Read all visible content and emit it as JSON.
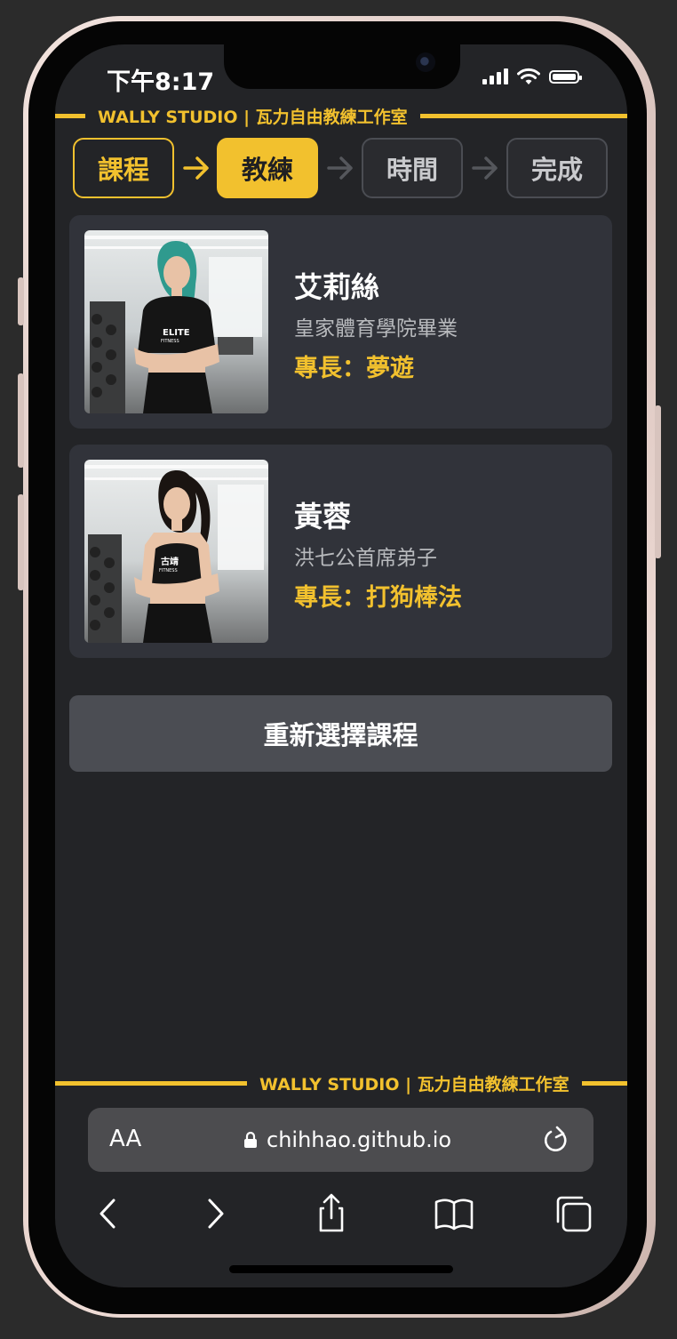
{
  "status": {
    "time": "下午8:17"
  },
  "brand": {
    "text": "WALLY STUDIO | 瓦力自由教練工作室"
  },
  "steps": [
    {
      "label": "課程",
      "state": "done"
    },
    {
      "label": "教練",
      "state": "active"
    },
    {
      "label": "時間",
      "state": "todo"
    },
    {
      "label": "完成",
      "state": "todo"
    }
  ],
  "coaches": [
    {
      "name": "艾莉絲",
      "school": "皇家體育學院畢業",
      "skill": "專長：夢遊",
      "shirt_text": "ELITE",
      "shirt_sub": "FITNESS",
      "hair_color": "#2f9a8e"
    },
    {
      "name": "黃蓉",
      "school": "洪七公首席弟子",
      "skill": "專長：打狗棒法",
      "shirt_text": "古靖",
      "shirt_sub": "FITNESS",
      "hair_color": "#1a1411"
    }
  ],
  "actions": {
    "reselect_label": "重新選擇課程"
  },
  "browser": {
    "aa_label": "AA",
    "url": "chihhao.github.io"
  },
  "colors": {
    "accent": "#f2c12e",
    "card": "#31333a",
    "screen": "#232427",
    "button": "#4b4d53"
  },
  "icons": [
    "signal-icon",
    "wifi-icon",
    "battery-icon",
    "lock-icon",
    "reload-icon",
    "back-icon",
    "forward-icon",
    "share-icon",
    "bookmarks-icon",
    "tabs-icon"
  ]
}
